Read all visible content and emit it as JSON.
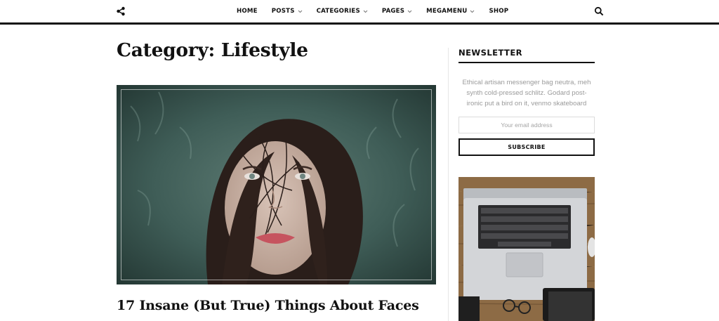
{
  "nav": {
    "items": [
      {
        "label": "HOME",
        "has_dropdown": false
      },
      {
        "label": "POSTS",
        "has_dropdown": true
      },
      {
        "label": "CATEGORIES",
        "has_dropdown": true
      },
      {
        "label": "PAGES",
        "has_dropdown": true
      },
      {
        "label": "MEGAMENU",
        "has_dropdown": true
      },
      {
        "label": "SHOP",
        "has_dropdown": false
      }
    ],
    "left_icon": "share-icon",
    "right_icon": "search-icon"
  },
  "main": {
    "page_title": "Category: Lifestyle",
    "featured_post": {
      "image": "portrait-woman-fur-hood",
      "title": "17 Insane (But True) Things About Faces"
    }
  },
  "sidebar": {
    "newsletter": {
      "title": "NEWSLETTER",
      "text": "Ethical artisan messenger bag neutra, meh synth cold-pressed schlitz. Godard post-ironic put a bird on it, venmo skateboard",
      "email_placeholder": "Your email address",
      "email_value": "",
      "button_label": "SUBSCRIBE"
    },
    "promo_image": "laptop-on-wooden-desk"
  },
  "colors": {
    "text": "#111111",
    "muted": "#9a9a9a",
    "border": "#dcdcdc",
    "background": "#ffffff"
  }
}
